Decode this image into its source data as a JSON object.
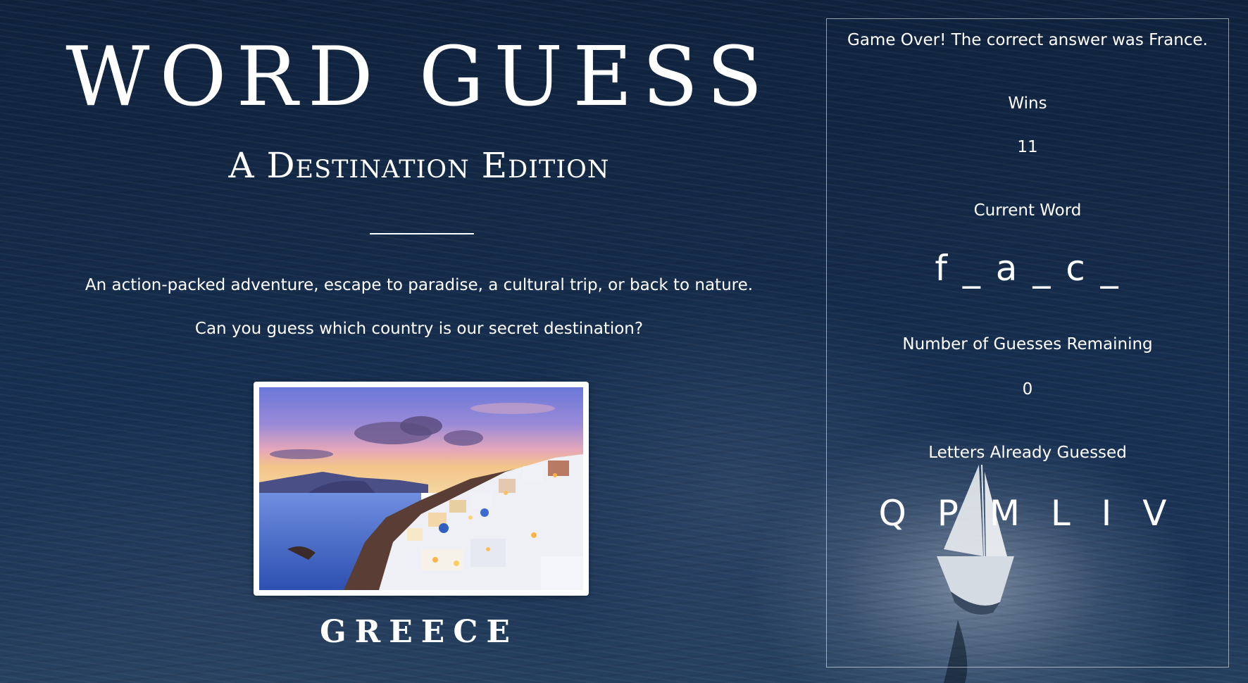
{
  "header": {
    "title": "WORD GUESS",
    "subtitle": "A Destination Edition"
  },
  "intro": {
    "line1": "An action-packed adventure, escape to paradise, a cultural trip, or back to nature.",
    "line2": "Can you guess which country is our secret destination?"
  },
  "destination": {
    "photo_icon": "santorini-photo",
    "caption": "GREECE"
  },
  "scoreboard": {
    "status_message": "Game Over! The correct answer was France.",
    "wins_label": "Wins",
    "wins_value": "11",
    "current_word_label": "Current Word",
    "current_word_value": "f _ a _ c _",
    "guesses_remaining_label": "Number of Guesses Remaining",
    "guesses_remaining_value": "0",
    "letters_guessed_label": "Letters Already Guessed",
    "letters_guessed_value": "Q P M L I V"
  },
  "colors": {
    "background": "#142a48",
    "text": "#ffffff",
    "panel_border": "#c8d0da"
  }
}
